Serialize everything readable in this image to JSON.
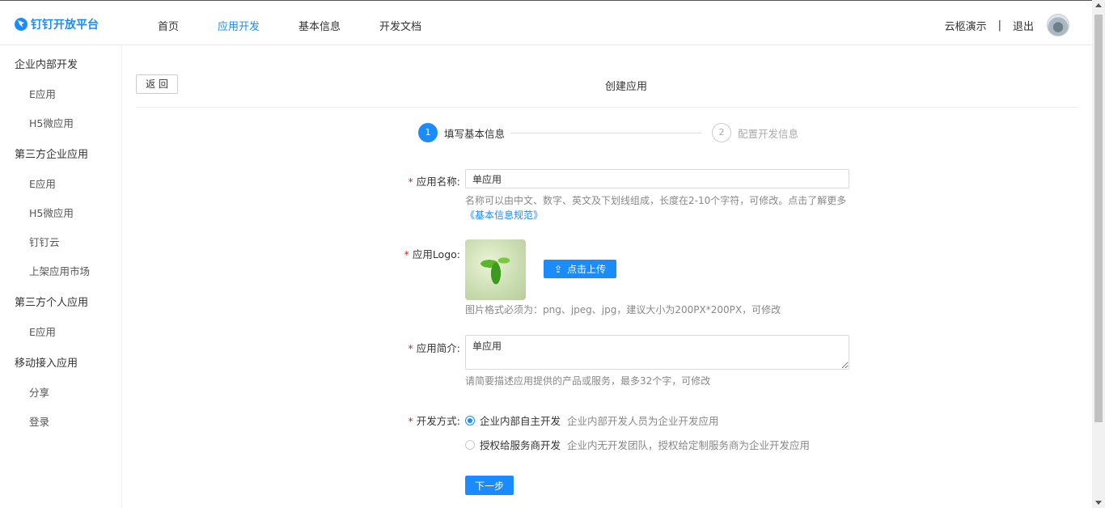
{
  "header": {
    "brand": "钉钉开放平台",
    "nav": [
      "首页",
      "应用开发",
      "基本信息",
      "开发文档"
    ],
    "active_nav_index": 1,
    "user_name": "云柩演示",
    "separator": "|",
    "logout": "退出"
  },
  "sidebar": {
    "groups": [
      {
        "title": "企业内部开发",
        "items": [
          "E应用",
          "H5微应用"
        ]
      },
      {
        "title": "第三方企业应用",
        "items": [
          "E应用",
          "H5微应用",
          "钉钉云",
          "上架应用市场"
        ]
      },
      {
        "title": "第三方个人应用",
        "items": [
          "E应用"
        ]
      },
      {
        "title": "移动接入应用",
        "items": [
          "分享",
          "登录"
        ]
      }
    ]
  },
  "main": {
    "back_label": "返 回",
    "title": "创建应用",
    "steps": [
      {
        "num": "1",
        "label": "填写基本信息",
        "active": true
      },
      {
        "num": "2",
        "label": "配置开发信息",
        "active": false
      }
    ],
    "form": {
      "name_label": "应用名称:",
      "name_value": "单应用",
      "name_hint": "名称可以由中文、数字、英文及下划线组成，长度在2-10个字符，可修改。点击了解更多",
      "name_hint_link": "《基本信息规范》",
      "logo_label": "应用Logo:",
      "upload_label": "点击上传",
      "logo_hint": "图片格式必须为：png、jpeg、jpg，建议大小为200PX*200PX，可修改",
      "desc_label": "应用简介:",
      "desc_value": "单应用",
      "desc_hint": "请简要描述应用提供的产品或服务，最多32个字，可修改",
      "mode_label": "开发方式:",
      "modes": [
        {
          "label": "企业内部自主开发",
          "desc": "企业内部开发人员为企业开发应用",
          "checked": true
        },
        {
          "label": "授权给服务商开发",
          "desc": "企业内无开发团队，授权给定制服务商为企业开发应用",
          "checked": false
        }
      ],
      "next_label": "下一步"
    }
  },
  "colors": {
    "accent": "#1a8cff",
    "required": "#e02020"
  }
}
